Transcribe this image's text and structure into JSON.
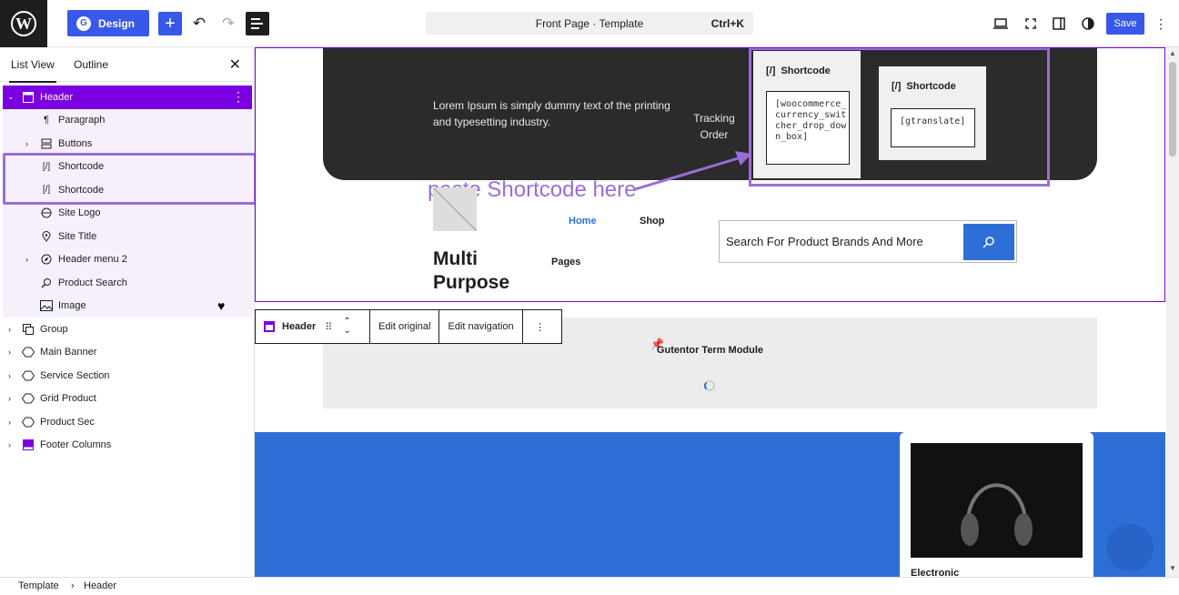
{
  "topbar": {
    "design_label": "Design",
    "document_title": "Front Page · Template",
    "shortcut": "Ctrl+K",
    "save_label": "Save"
  },
  "sidebar": {
    "tabs": [
      "List View",
      "Outline"
    ],
    "items": [
      {
        "label": "Header",
        "icon": "template-part-icon",
        "selected": true
      },
      {
        "label": "Paragraph",
        "icon": "paragraph-icon"
      },
      {
        "label": "Buttons",
        "icon": "buttons-icon"
      },
      {
        "label": "Shortcode",
        "icon": "shortcode-icon"
      },
      {
        "label": "Shortcode",
        "icon": "shortcode-icon"
      },
      {
        "label": "Site Logo",
        "icon": "site-logo-icon"
      },
      {
        "label": "Site Title",
        "icon": "map-pin-icon"
      },
      {
        "label": "Header menu 2",
        "icon": "navigation-icon"
      },
      {
        "label": "Product Search",
        "icon": "search-icon"
      },
      {
        "label": "Image",
        "icon": "image-icon"
      },
      {
        "label": "Group",
        "icon": "group-icon"
      },
      {
        "label": "Main Banner",
        "icon": "pattern-icon"
      },
      {
        "label": "Service Section",
        "icon": "pattern-icon"
      },
      {
        "label": "Grid Product",
        "icon": "pattern-icon"
      },
      {
        "label": "Product Sec",
        "icon": "pattern-icon"
      },
      {
        "label": "Footer Columns",
        "icon": "template-part-icon"
      }
    ]
  },
  "canvas": {
    "lorem": "Lorem Ipsum is simply dummy text of the printing and typesetting industry.",
    "tracking": "Tracking Order",
    "shortcode_block_title": "Shortcode",
    "shortcode1_value": "[woocommerce_currency_switcher_drop_down_box]",
    "shortcode2_value": "[gtranslate]",
    "annotation": "paste Shortcode here",
    "site_title": "Multi Purpose",
    "nav": {
      "home": "Home",
      "shop": "Shop",
      "pages": "Pages"
    },
    "search_placeholder": "Search For Product Brands And More",
    "toolbar": {
      "block": "Header",
      "edit_original": "Edit original",
      "edit_navigation": "Edit navigation"
    },
    "term_module": "Gutentor Term Module",
    "product_label": "Electronic"
  },
  "breadcrumb": {
    "root": "Template",
    "current": "Header"
  },
  "colors": {
    "accent": "#3858e9",
    "template_part": "#7a00df",
    "annotation": "#9b6dd6",
    "brand_blue": "#2d6fd6"
  }
}
